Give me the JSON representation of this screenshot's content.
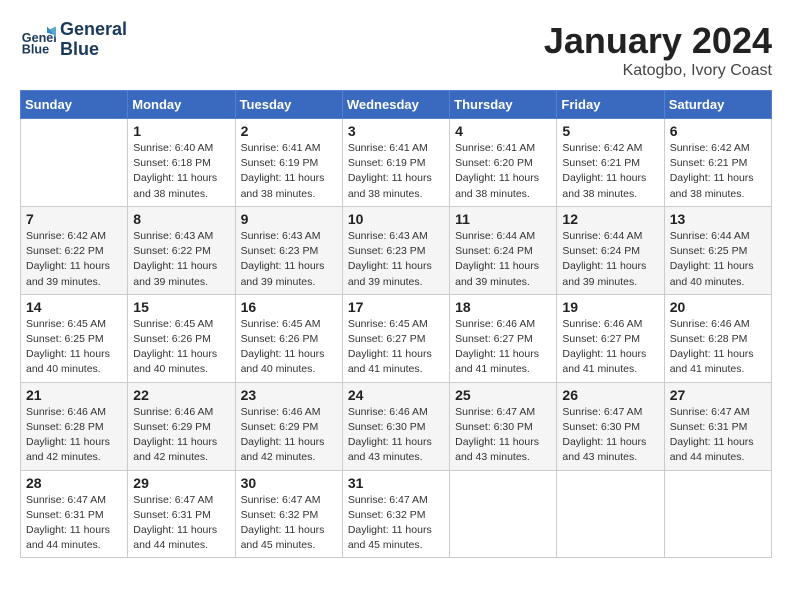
{
  "header": {
    "logo_line1": "General",
    "logo_line2": "Blue",
    "month": "January 2024",
    "location": "Katogbo, Ivory Coast"
  },
  "weekdays": [
    "Sunday",
    "Monday",
    "Tuesday",
    "Wednesday",
    "Thursday",
    "Friday",
    "Saturday"
  ],
  "weeks": [
    [
      {
        "day": "",
        "info": ""
      },
      {
        "day": "1",
        "info": "Sunrise: 6:40 AM\nSunset: 6:18 PM\nDaylight: 11 hours\nand 38 minutes."
      },
      {
        "day": "2",
        "info": "Sunrise: 6:41 AM\nSunset: 6:19 PM\nDaylight: 11 hours\nand 38 minutes."
      },
      {
        "day": "3",
        "info": "Sunrise: 6:41 AM\nSunset: 6:19 PM\nDaylight: 11 hours\nand 38 minutes."
      },
      {
        "day": "4",
        "info": "Sunrise: 6:41 AM\nSunset: 6:20 PM\nDaylight: 11 hours\nand 38 minutes."
      },
      {
        "day": "5",
        "info": "Sunrise: 6:42 AM\nSunset: 6:21 PM\nDaylight: 11 hours\nand 38 minutes."
      },
      {
        "day": "6",
        "info": "Sunrise: 6:42 AM\nSunset: 6:21 PM\nDaylight: 11 hours\nand 38 minutes."
      }
    ],
    [
      {
        "day": "7",
        "info": "Sunrise: 6:42 AM\nSunset: 6:22 PM\nDaylight: 11 hours\nand 39 minutes."
      },
      {
        "day": "8",
        "info": "Sunrise: 6:43 AM\nSunset: 6:22 PM\nDaylight: 11 hours\nand 39 minutes."
      },
      {
        "day": "9",
        "info": "Sunrise: 6:43 AM\nSunset: 6:23 PM\nDaylight: 11 hours\nand 39 minutes."
      },
      {
        "day": "10",
        "info": "Sunrise: 6:43 AM\nSunset: 6:23 PM\nDaylight: 11 hours\nand 39 minutes."
      },
      {
        "day": "11",
        "info": "Sunrise: 6:44 AM\nSunset: 6:24 PM\nDaylight: 11 hours\nand 39 minutes."
      },
      {
        "day": "12",
        "info": "Sunrise: 6:44 AM\nSunset: 6:24 PM\nDaylight: 11 hours\nand 39 minutes."
      },
      {
        "day": "13",
        "info": "Sunrise: 6:44 AM\nSunset: 6:25 PM\nDaylight: 11 hours\nand 40 minutes."
      }
    ],
    [
      {
        "day": "14",
        "info": "Sunrise: 6:45 AM\nSunset: 6:25 PM\nDaylight: 11 hours\nand 40 minutes."
      },
      {
        "day": "15",
        "info": "Sunrise: 6:45 AM\nSunset: 6:26 PM\nDaylight: 11 hours\nand 40 minutes."
      },
      {
        "day": "16",
        "info": "Sunrise: 6:45 AM\nSunset: 6:26 PM\nDaylight: 11 hours\nand 40 minutes."
      },
      {
        "day": "17",
        "info": "Sunrise: 6:45 AM\nSunset: 6:27 PM\nDaylight: 11 hours\nand 41 minutes."
      },
      {
        "day": "18",
        "info": "Sunrise: 6:46 AM\nSunset: 6:27 PM\nDaylight: 11 hours\nand 41 minutes."
      },
      {
        "day": "19",
        "info": "Sunrise: 6:46 AM\nSunset: 6:27 PM\nDaylight: 11 hours\nand 41 minutes."
      },
      {
        "day": "20",
        "info": "Sunrise: 6:46 AM\nSunset: 6:28 PM\nDaylight: 11 hours\nand 41 minutes."
      }
    ],
    [
      {
        "day": "21",
        "info": "Sunrise: 6:46 AM\nSunset: 6:28 PM\nDaylight: 11 hours\nand 42 minutes."
      },
      {
        "day": "22",
        "info": "Sunrise: 6:46 AM\nSunset: 6:29 PM\nDaylight: 11 hours\nand 42 minutes."
      },
      {
        "day": "23",
        "info": "Sunrise: 6:46 AM\nSunset: 6:29 PM\nDaylight: 11 hours\nand 42 minutes."
      },
      {
        "day": "24",
        "info": "Sunrise: 6:46 AM\nSunset: 6:30 PM\nDaylight: 11 hours\nand 43 minutes."
      },
      {
        "day": "25",
        "info": "Sunrise: 6:47 AM\nSunset: 6:30 PM\nDaylight: 11 hours\nand 43 minutes."
      },
      {
        "day": "26",
        "info": "Sunrise: 6:47 AM\nSunset: 6:30 PM\nDaylight: 11 hours\nand 43 minutes."
      },
      {
        "day": "27",
        "info": "Sunrise: 6:47 AM\nSunset: 6:31 PM\nDaylight: 11 hours\nand 44 minutes."
      }
    ],
    [
      {
        "day": "28",
        "info": "Sunrise: 6:47 AM\nSunset: 6:31 PM\nDaylight: 11 hours\nand 44 minutes."
      },
      {
        "day": "29",
        "info": "Sunrise: 6:47 AM\nSunset: 6:31 PM\nDaylight: 11 hours\nand 44 minutes."
      },
      {
        "day": "30",
        "info": "Sunrise: 6:47 AM\nSunset: 6:32 PM\nDaylight: 11 hours\nand 45 minutes."
      },
      {
        "day": "31",
        "info": "Sunrise: 6:47 AM\nSunset: 6:32 PM\nDaylight: 11 hours\nand 45 minutes."
      },
      {
        "day": "",
        "info": ""
      },
      {
        "day": "",
        "info": ""
      },
      {
        "day": "",
        "info": ""
      }
    ]
  ]
}
